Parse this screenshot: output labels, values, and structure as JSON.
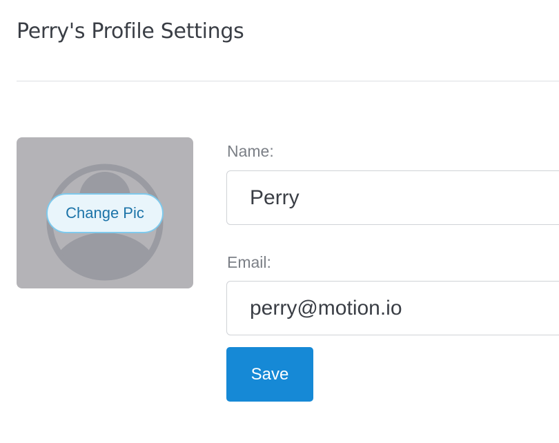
{
  "header": {
    "title": "Perry's Profile Settings"
  },
  "avatar": {
    "icon": "user-avatar-icon",
    "change_label": "Change Pic"
  },
  "form": {
    "name_label": "Name:",
    "name_value": "Perry",
    "email_label": "Email:",
    "email_value": "perry@motion.io",
    "save_label": "Save"
  },
  "colors": {
    "accent": "#1689d6",
    "change_pic_border": "#7ec9ec",
    "avatar_background": "#b4b3b7"
  }
}
